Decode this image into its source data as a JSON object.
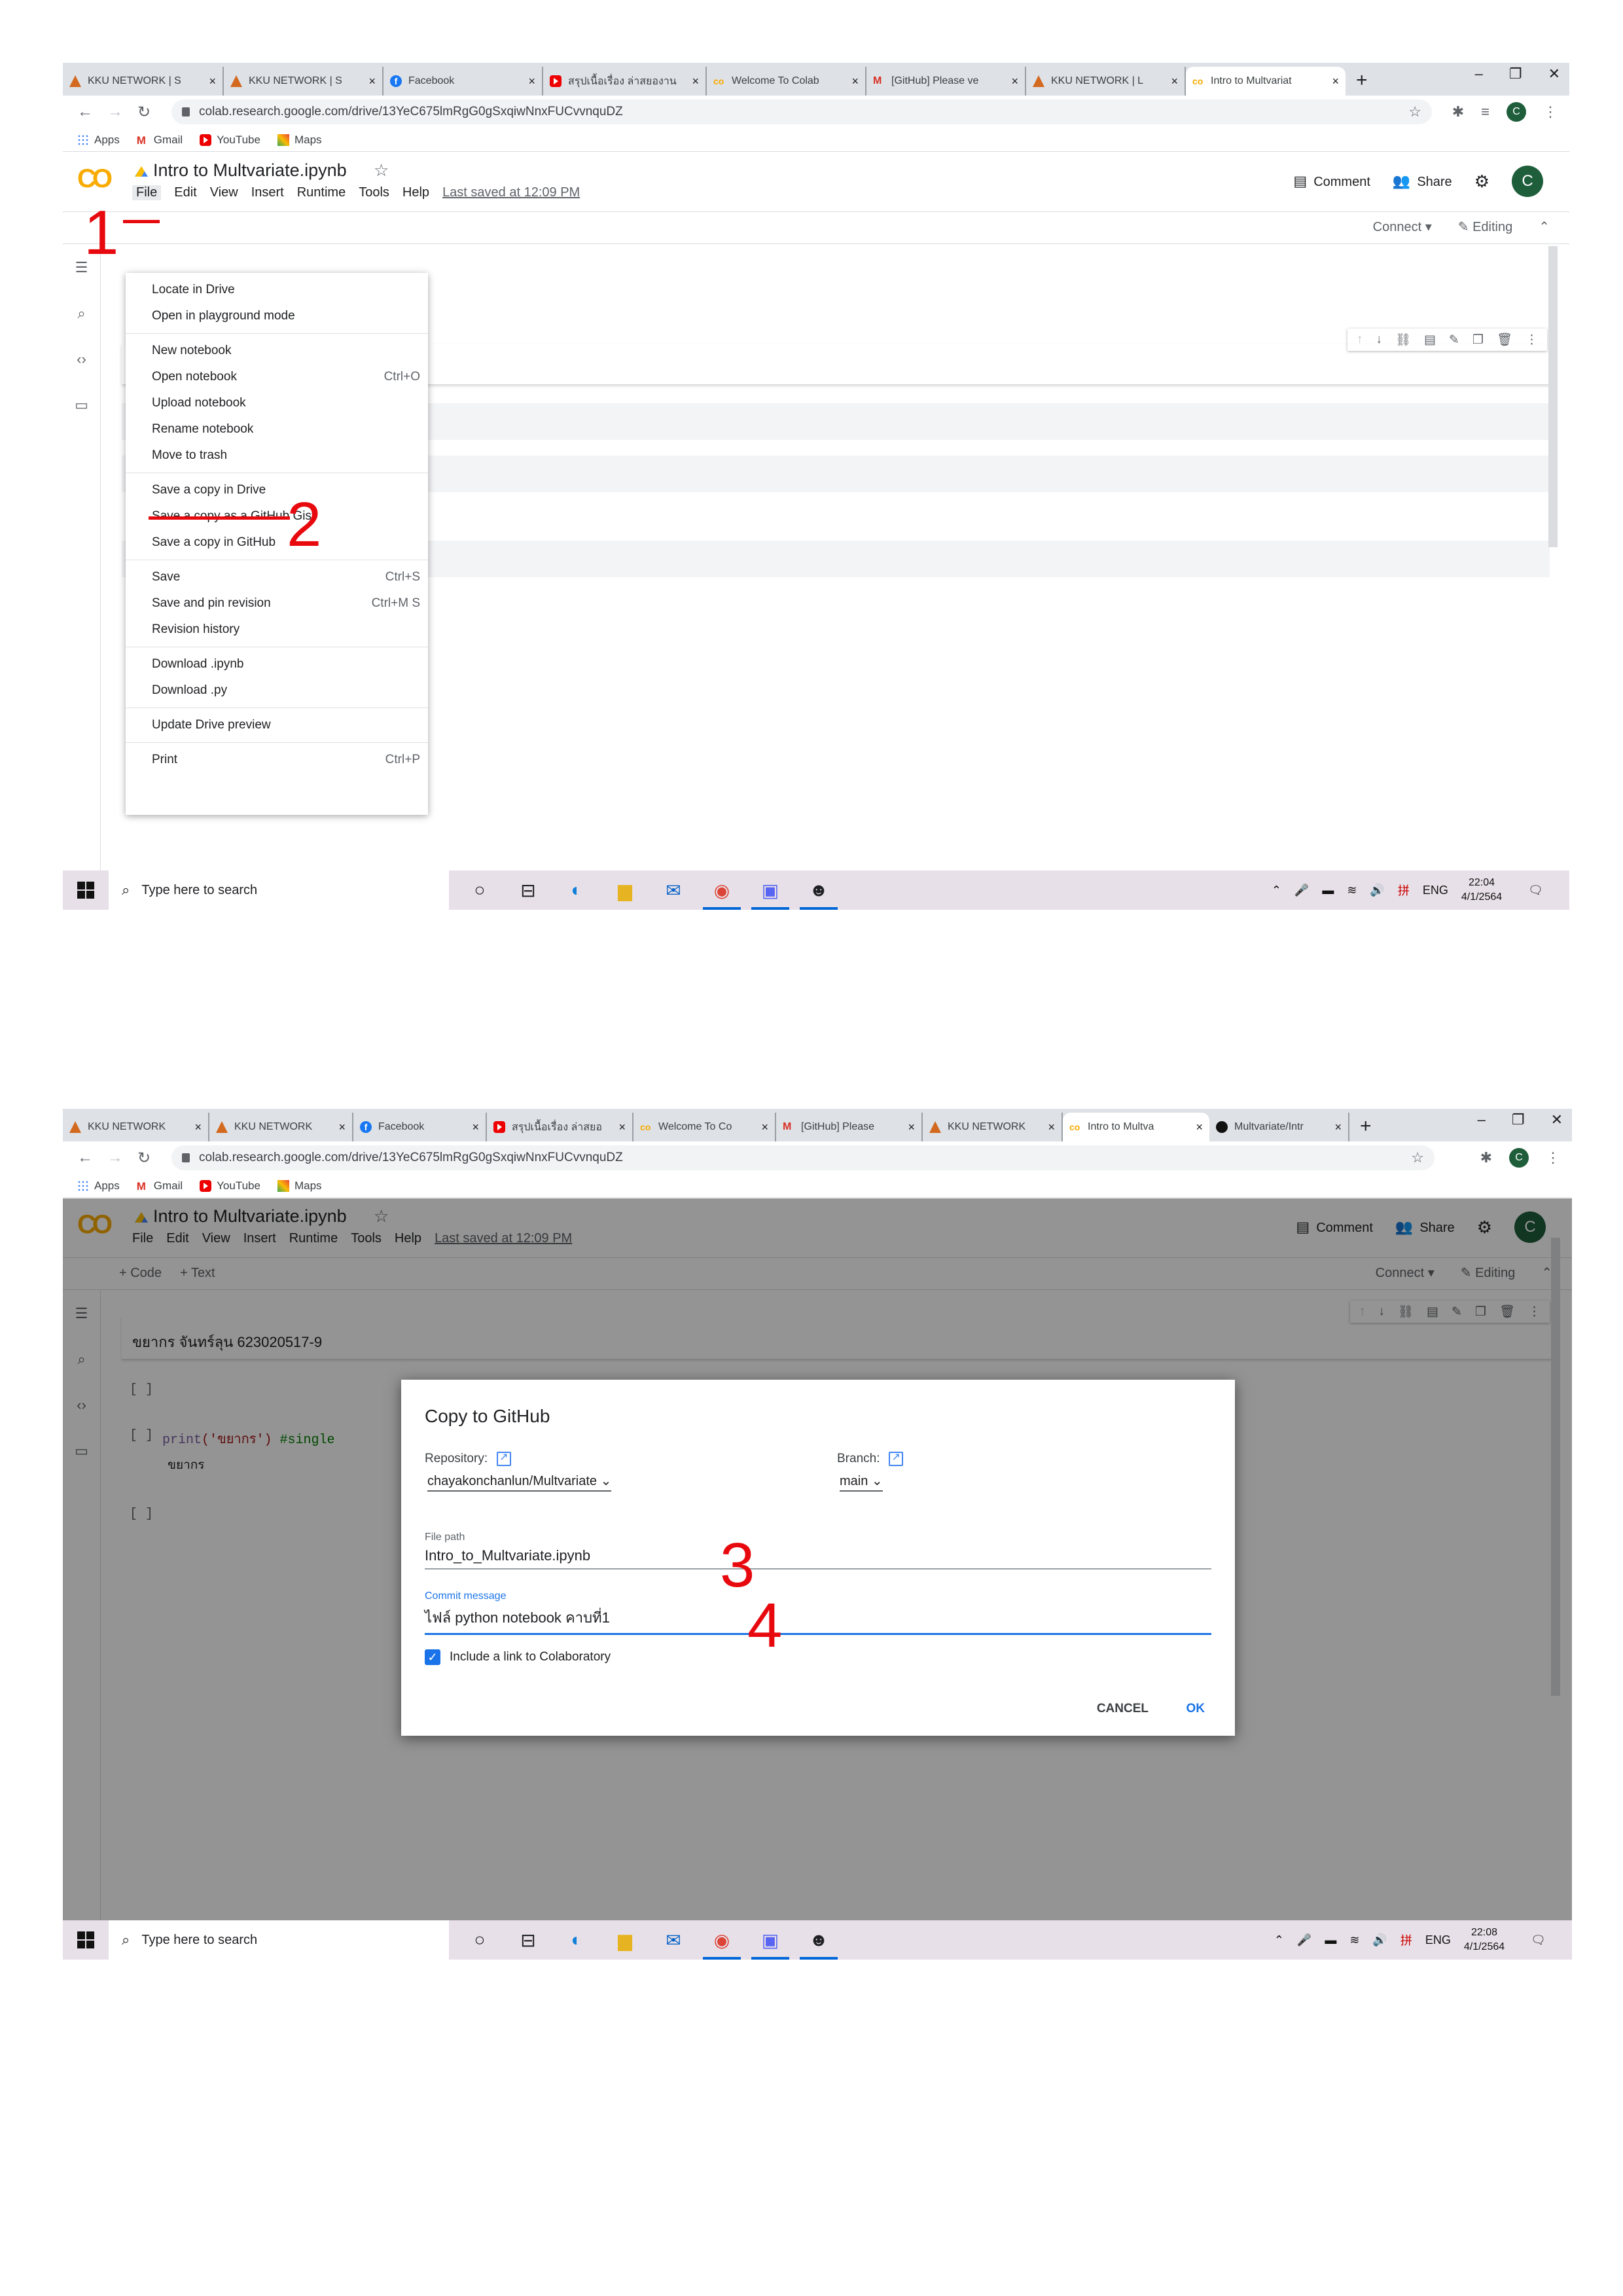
{
  "shot1": {
    "tabs": [
      {
        "icon": "kku",
        "label": "KKU NETWORK | S"
      },
      {
        "icon": "kku",
        "label": "KKU NETWORK | S"
      },
      {
        "icon": "facebook",
        "label": "Facebook"
      },
      {
        "icon": "youtube",
        "label": "สรุปเนื้อเรื่อง ล่าสยองาน"
      },
      {
        "icon": "colab",
        "label": "Welcome To Colab"
      },
      {
        "icon": "gmail",
        "label": "[GitHub] Please ve"
      },
      {
        "icon": "kku",
        "label": "KKU NETWORK | L"
      },
      {
        "icon": "colab",
        "label": "Intro to Multvariat"
      }
    ],
    "url": "colab.research.google.com/drive/13YeC675lmRgG0gSxqiwNnxFUCvvnquDZ",
    "notebook_title": "Intro to Multvariate.ipynb",
    "menubar": [
      "File",
      "Edit",
      "View",
      "Insert",
      "Runtime",
      "Tools",
      "Help"
    ],
    "last_saved": "Last saved at 12:09 PM",
    "file_menu": [
      [
        {
          "label": "Locate in Drive",
          "shortcut": ""
        },
        {
          "label": "Open in playground mode",
          "shortcut": ""
        }
      ],
      [
        {
          "label": "New notebook",
          "shortcut": ""
        },
        {
          "label": "Open notebook",
          "shortcut": "Ctrl+O"
        },
        {
          "label": "Upload notebook",
          "shortcut": ""
        },
        {
          "label": "Rename notebook",
          "shortcut": ""
        },
        {
          "label": "Move to trash",
          "shortcut": ""
        }
      ],
      [
        {
          "label": "Save a copy in Drive",
          "shortcut": ""
        },
        {
          "label": "Save a copy as a GitHub Gist",
          "shortcut": ""
        },
        {
          "label": "Save a copy in GitHub",
          "shortcut": ""
        }
      ],
      [
        {
          "label": "Save",
          "shortcut": "Ctrl+S"
        },
        {
          "label": "Save and pin revision",
          "shortcut": "Ctrl+M S"
        },
        {
          "label": "Revision history",
          "shortcut": ""
        }
      ],
      [
        {
          "label": "Download .ipynb",
          "shortcut": ""
        },
        {
          "label": "Download .py",
          "shortcut": ""
        }
      ],
      [
        {
          "label": "Update Drive preview",
          "shortcut": ""
        }
      ],
      [
        {
          "label": "Print",
          "shortcut": "Ctrl+P"
        }
      ]
    ],
    "annotations": {
      "step1": "1",
      "step2": "2"
    },
    "clock": {
      "time": "22:04",
      "date": "4/1/2564"
    }
  },
  "shot2": {
    "tabs": [
      {
        "icon": "kku",
        "label": "KKU NETWORK"
      },
      {
        "icon": "kku",
        "label": "KKU NETWORK"
      },
      {
        "icon": "facebook",
        "label": "Facebook"
      },
      {
        "icon": "youtube",
        "label": "สรุปเนื้อเรื่อง ล่าสยอ"
      },
      {
        "icon": "colab",
        "label": "Welcome To Co"
      },
      {
        "icon": "gmail",
        "label": "[GitHub] Please"
      },
      {
        "icon": "kku",
        "label": "KKU NETWORK"
      },
      {
        "icon": "colab",
        "label": "Intro to Multva"
      },
      {
        "icon": "github",
        "label": "Multvariate/Intr"
      }
    ],
    "url": "colab.research.google.com/drive/13YeC675lmRgG0gSxqiwNnxFUCvvnquDZ",
    "text_cell": "ขยากร จันทร์ลุน 623020517-9",
    "code_print": "print",
    "code_string": "('ขยากร')",
    "code_comment": "#single",
    "output_text": "ขยากร",
    "dialog": {
      "title": "Copy to GitHub",
      "repo_label": "Repository:",
      "repo_value": "chayakonchanlun/Multvariate",
      "branch_label": "Branch:",
      "branch_value": "main",
      "file_path_label": "File path",
      "file_path_value": "Intro_to_Multvariate.ipynb",
      "commit_label": "Commit message",
      "commit_value": "ไฟล์ python notebook คาบที่1",
      "include_link": "Include a link to Colaboratory",
      "cancel": "CANCEL",
      "ok": "OK"
    },
    "annotations": {
      "step3": "3",
      "step4": "4"
    },
    "clock": {
      "time": "22:08",
      "date": "4/1/2564"
    }
  },
  "common": {
    "bookmarks": [
      "Apps",
      "Gmail",
      "YouTube",
      "Maps"
    ],
    "comment": "Comment",
    "share": "Share",
    "avatar_letter": "C",
    "add_code": "+ Code",
    "add_text": "+ Text",
    "connect": "Connect",
    "editing": "Editing",
    "search_placeholder": "Type here to search",
    "lang": "ENG",
    "colors": {
      "accent": "#1a73e8",
      "annotation": "#e8090e",
      "colab_logo": "#f9ab00"
    }
  }
}
